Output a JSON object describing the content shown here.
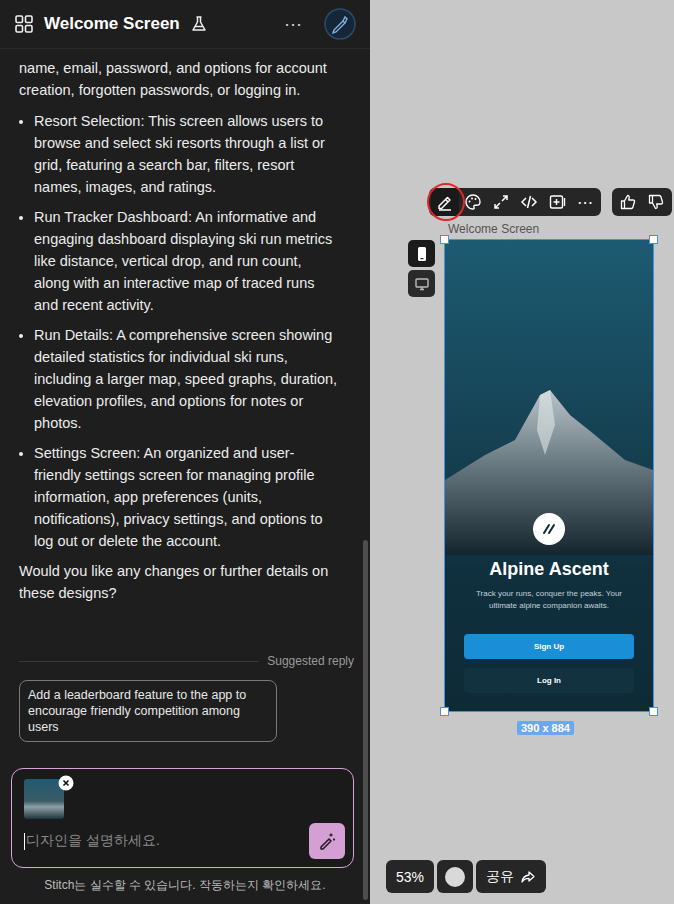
{
  "header": {
    "title": "Welcome Screen",
    "more": "⋯"
  },
  "chat": {
    "lead_text": "name, email, password, and options for account creation, forgotten passwords, or logging in.",
    "bullets": [
      "Resort Selection: This screen allows users to browse and select ski resorts through a list or grid, featuring a search bar, filters, resort names, images, and ratings.",
      "Run Tracker Dashboard: An informative and engaging dashboard displaying ski run metrics like distance, vertical drop, and run count, along with an interactive map of traced runs and recent activity.",
      "Run Details: A comprehensive screen showing detailed statistics for individual ski runs, including a larger map, speed graphs, duration, elevation profiles, and options for notes or photos.",
      "Settings Screen: An organized and user-friendly settings screen for managing profile information, app preferences (units, notifications), privacy settings, and options to log out or delete the account."
    ],
    "closing": "Would you like any changes or further details on these designs?",
    "suggested_label": "Suggested reply",
    "suggestions": [
      "Add a leaderboard feature to the app to encourage friendly competition among users"
    ]
  },
  "composer": {
    "placeholder": "디자인을 설명하세요.",
    "has_attachment": true
  },
  "disclaimer": "Stitch는 실수할 수 있습니다. 작동하는지 확인하세요.",
  "canvas": {
    "toolbar": [
      {
        "kind": "edit",
        "highlighted": true
      },
      {
        "kind": "palette",
        "highlighted": false
      },
      {
        "kind": "expand",
        "highlighted": false
      },
      {
        "kind": "code",
        "highlighted": false
      },
      {
        "kind": "add-frame",
        "highlighted": false
      }
    ],
    "toolbar_more": "⋯",
    "frame_label": "Welcome Screen",
    "devices": [
      {
        "kind": "mobile",
        "selected": true
      },
      {
        "kind": "desktop",
        "selected": false
      }
    ],
    "frame": {
      "selected": true,
      "app_name": "Alpine Ascent",
      "tagline": "Track your runs, conquer the peaks. Your ultimate alpine companion awaits.",
      "buttons": [
        {
          "label": "Sign Up",
          "kind": "primary"
        },
        {
          "label": "Log In",
          "kind": "secondary"
        }
      ]
    },
    "frame_size": "390 x 884",
    "zoom": "53%",
    "share": "공유"
  }
}
